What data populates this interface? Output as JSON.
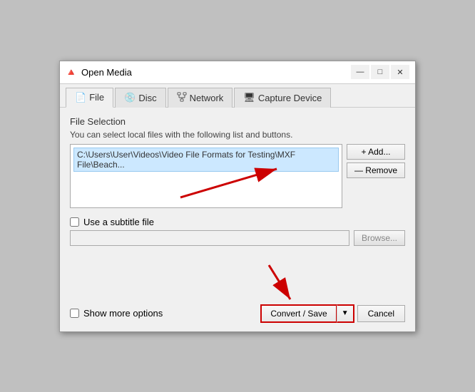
{
  "window": {
    "title": "Open Media",
    "title_icon": "🔺",
    "controls": {
      "minimize": "—",
      "maximize": "□",
      "close": "✕"
    }
  },
  "tabs": [
    {
      "id": "file",
      "label": "File",
      "icon": "📄",
      "active": true
    },
    {
      "id": "disc",
      "label": "Disc",
      "icon": "💿",
      "active": false
    },
    {
      "id": "network",
      "label": "Network",
      "icon": "🖧",
      "active": false
    },
    {
      "id": "capture",
      "label": "Capture Device",
      "icon": "🖥",
      "active": false
    }
  ],
  "file_section": {
    "title": "File Selection",
    "description": "You can select local files with the following list and buttons.",
    "file_path": "C:\\Users\\User\\Videos\\Video File Formats for Testing\\MXF File\\Beach...",
    "add_button": "+ Add...",
    "remove_button": "— Remove"
  },
  "subtitle": {
    "checkbox_label": "Use a subtitle file",
    "input_value": "",
    "browse_button": "Browse..."
  },
  "bottom": {
    "show_more_label": "Show more options",
    "convert_save": "Convert / Save",
    "convert_arrow": "▼",
    "cancel": "Cancel"
  }
}
